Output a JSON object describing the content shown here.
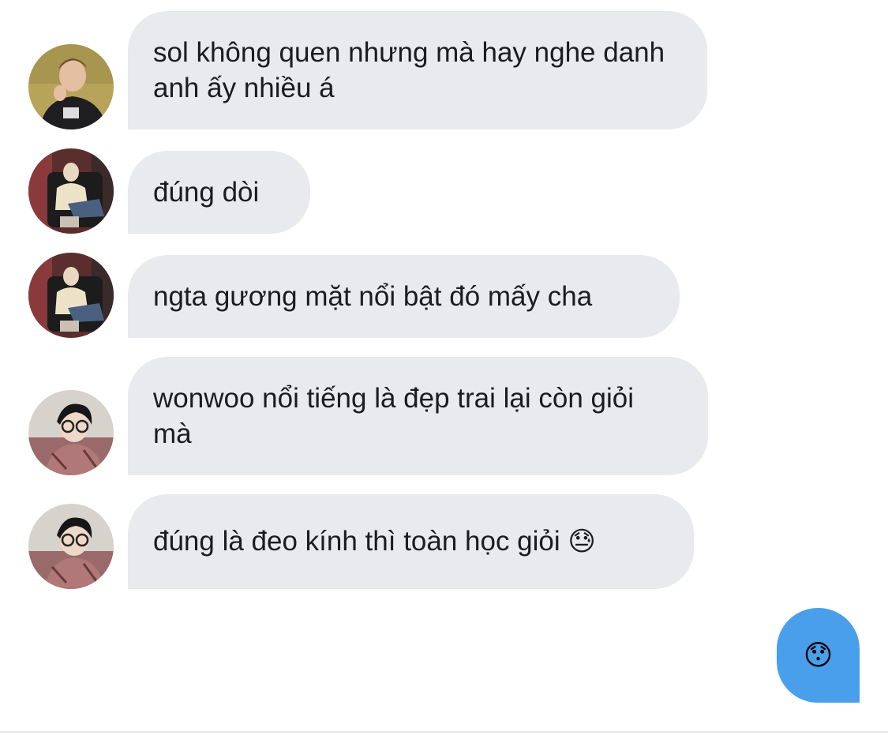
{
  "messages": [
    {
      "text": "sol không quen nhưng mà hay nghe danh anh ấy nhiều á",
      "emoji": "",
      "avatar": "avatar-user-1"
    },
    {
      "text": "đúng dòi",
      "emoji": "",
      "avatar": "avatar-user-2"
    },
    {
      "text": "ngta gương mặt nổi bật đó mấy cha",
      "emoji": "",
      "avatar": "avatar-user-2"
    },
    {
      "text": "wonwoo nổi tiếng là đẹp trai lại còn giỏi mà",
      "emoji": "",
      "avatar": "avatar-user-3"
    },
    {
      "text": "đúng là đeo kính thì toàn học giỏi ",
      "emoji": "😓",
      "avatar": "avatar-user-3"
    }
  ],
  "own_message": {
    "emoji": "😯"
  },
  "colors": {
    "incoming_bubble": "#e8eaee",
    "outgoing_bubble": "#4a9fea",
    "text": "#1c1c1e"
  }
}
